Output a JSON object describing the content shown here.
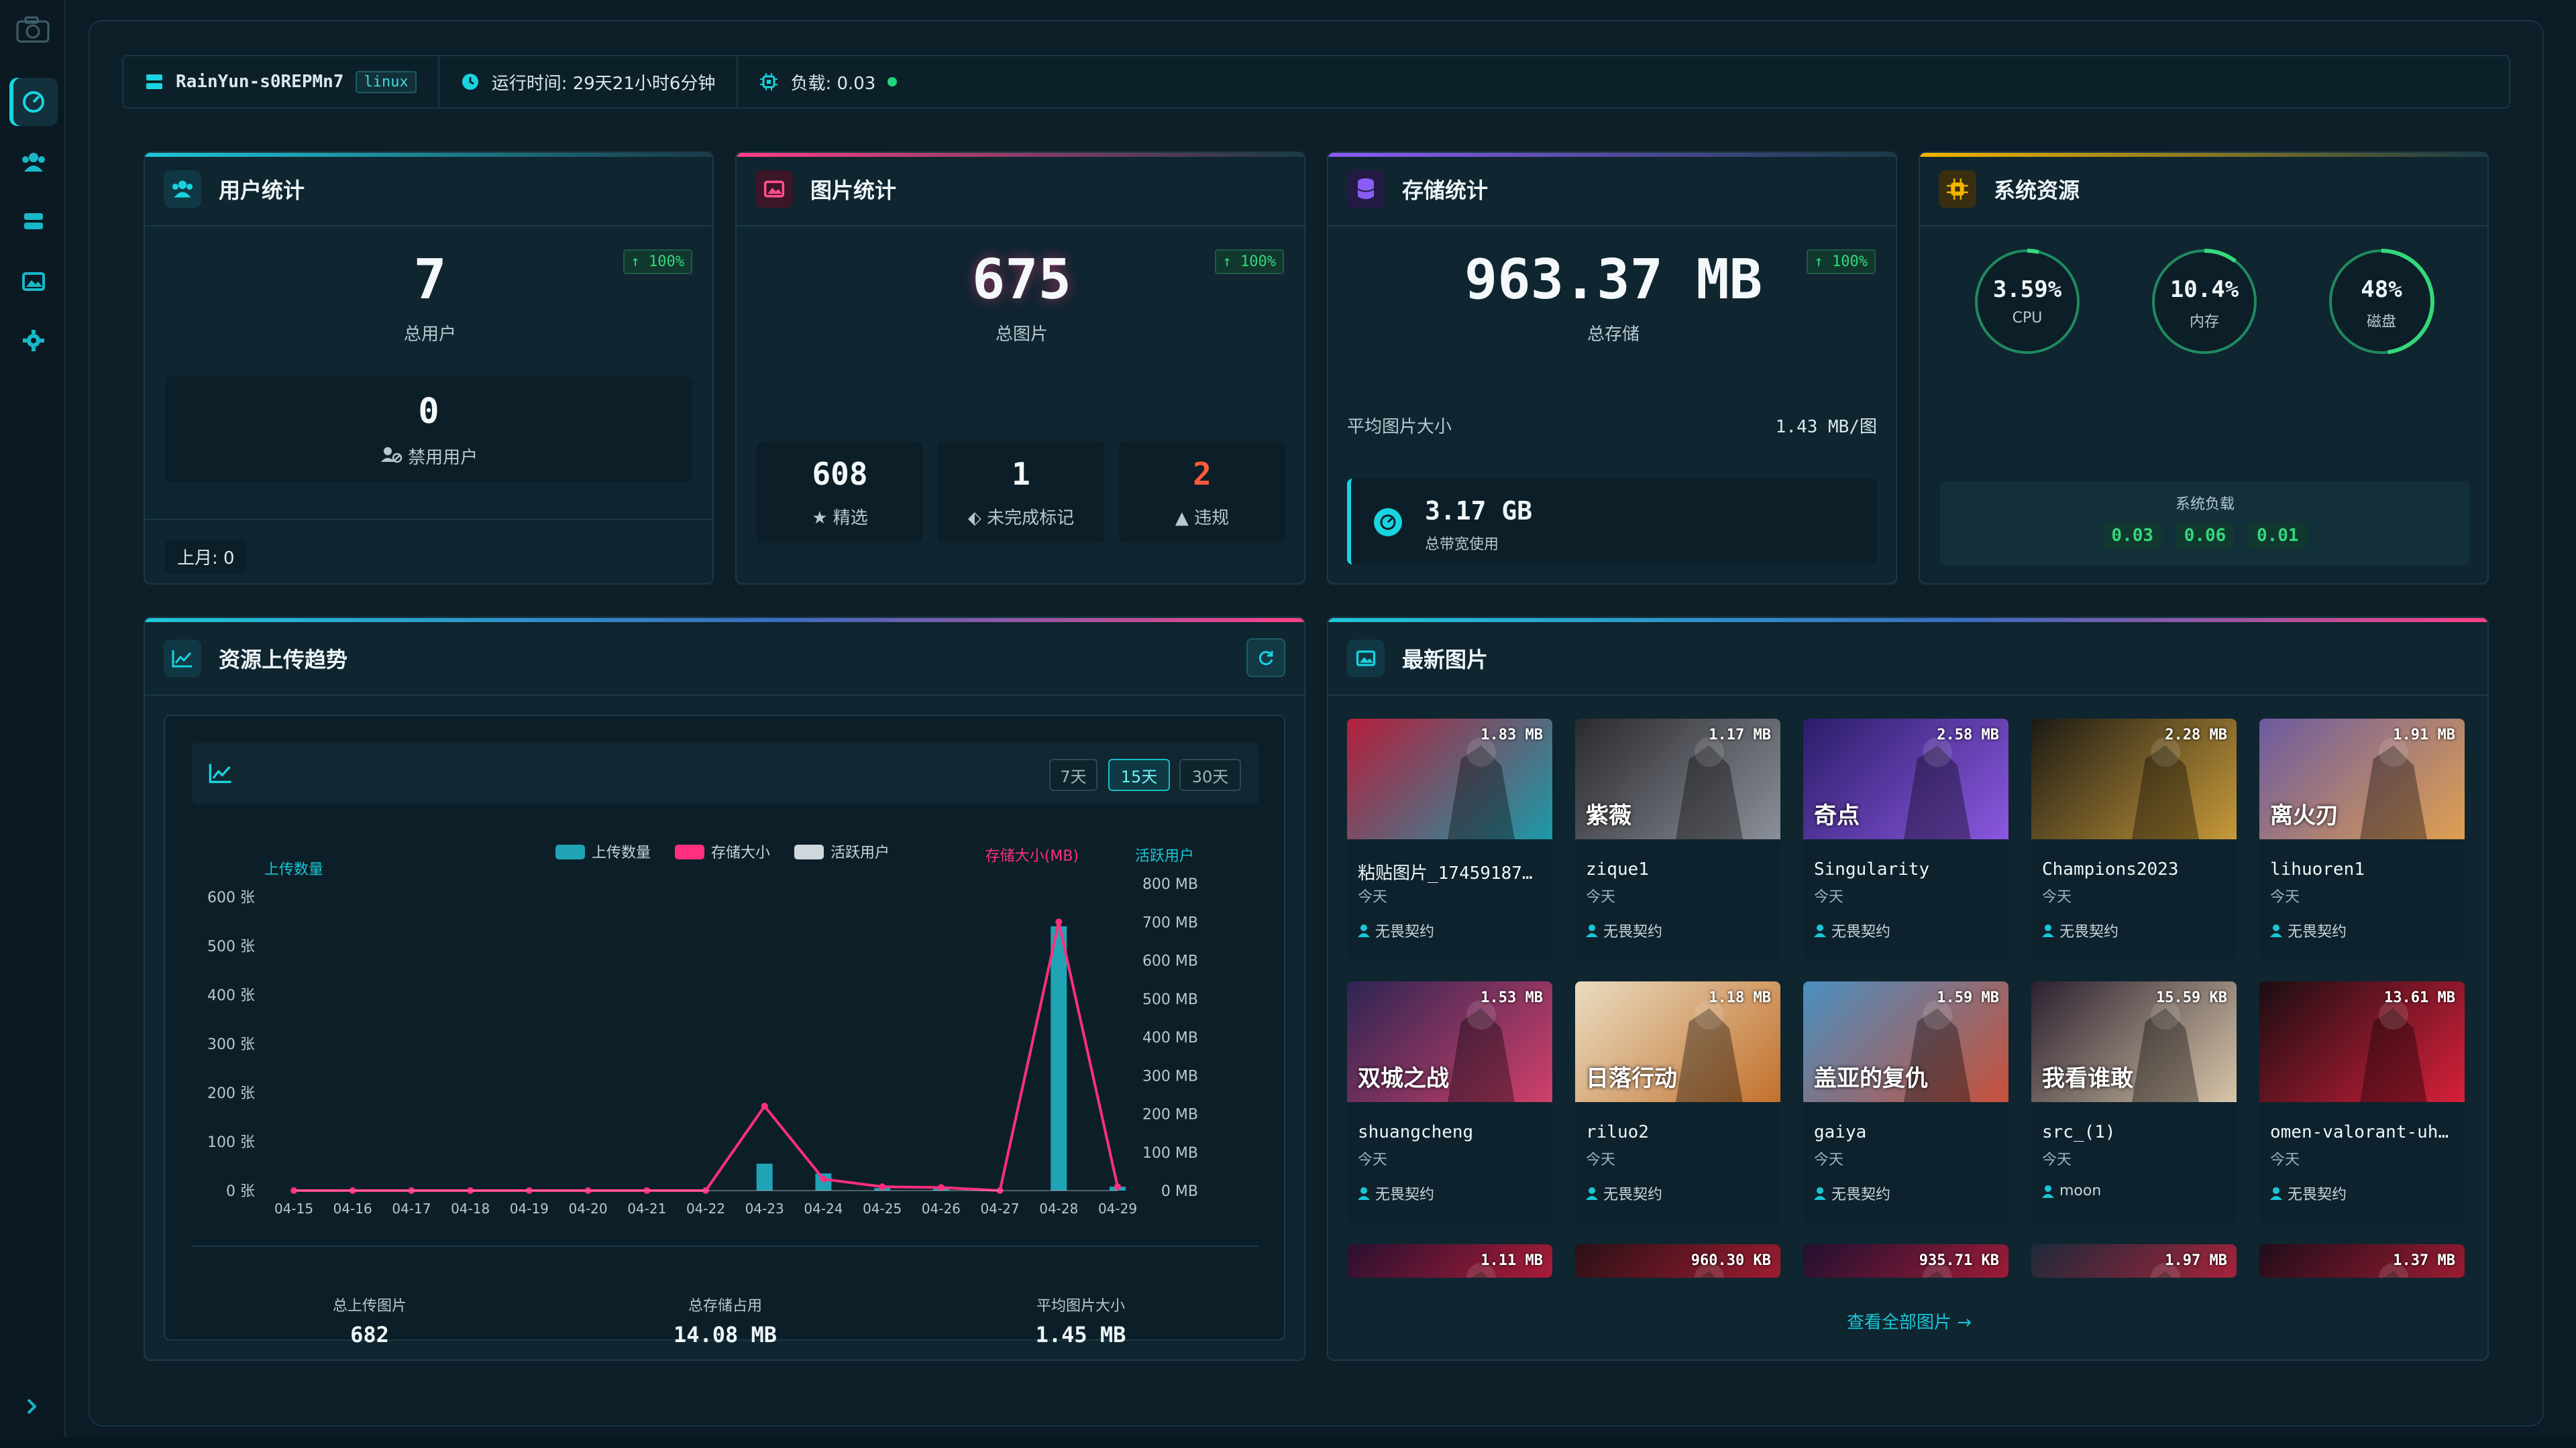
{
  "status": {
    "host": "RainYun-s0REPMn7",
    "os": "linux",
    "uptime": "运行时间: 29天21小时6分钟",
    "load": "负载: 0.03"
  },
  "users": {
    "title": "用户统计",
    "total": "7",
    "total_label": "总用户",
    "growth": "100%",
    "banned": "0",
    "banned_label": "禁用用户",
    "last_month": "上月: 0"
  },
  "images": {
    "title": "图片统计",
    "total": "675",
    "total_label": "总图片",
    "growth": "100%",
    "featured": "608",
    "featured_label": "精选",
    "unmarked": "1",
    "unmarked_label": "未完成标记",
    "violations": "2",
    "violations_label": "违规"
  },
  "storage": {
    "title": "存储统计",
    "total": "963.37 MB",
    "total_label": "总存储",
    "growth": "100%",
    "avg_label": "平均图片大小",
    "avg_value": "1.43 MB/图",
    "bandwidth": "3.17 GB",
    "bandwidth_label": "总带宽使用"
  },
  "system": {
    "title": "系统资源",
    "cpu": {
      "value": "3.59%",
      "label": "CPU",
      "fraction": 0.0359
    },
    "mem": {
      "value": "10.4%",
      "label": "内存",
      "fraction": 0.104
    },
    "disk": {
      "value": "48%",
      "label": "磁盘",
      "fraction": 0.48
    },
    "load_title": "系统负载",
    "loads": [
      "0.03",
      "0.06",
      "0.01"
    ]
  },
  "trend": {
    "title": "资源上传趋势",
    "ranges": [
      "7天",
      "15天",
      "30天"
    ],
    "active_range": "15天",
    "summary": [
      {
        "label": "总上传图片",
        "value": "682"
      },
      {
        "label": "总存储占用",
        "value": "14.08 MB"
      },
      {
        "label": "平均图片大小",
        "value": "1.45 MB"
      }
    ]
  },
  "chart_data": {
    "type": "bar",
    "categories": [
      "04-15",
      "04-16",
      "04-17",
      "04-18",
      "04-19",
      "04-20",
      "04-21",
      "04-22",
      "04-23",
      "04-24",
      "04-25",
      "04-26",
      "04-27",
      "04-28",
      "04-29"
    ],
    "series": [
      {
        "name": "上传数量",
        "type": "bar",
        "axis": "left",
        "color": "#1fa3b5",
        "values": [
          0,
          0,
          0,
          0,
          0,
          0,
          0,
          0,
          55,
          35,
          5,
          4,
          0,
          540,
          8
        ]
      },
      {
        "name": "存储大小",
        "type": "line",
        "axis": "right",
        "color": "#ff2f7d",
        "values": [
          0,
          0,
          0,
          0,
          0,
          0,
          0,
          0,
          220,
          30,
          10,
          8,
          0,
          700,
          10
        ]
      },
      {
        "name": "活跃用户",
        "type": "line",
        "axis": "right2",
        "color": "#cfd8dc",
        "values": [
          0,
          0,
          0,
          0,
          0,
          0,
          0,
          0,
          0,
          0,
          0,
          0,
          0,
          0,
          0
        ]
      }
    ],
    "y_left": {
      "label": "上传数量",
      "ticks": [
        "0 张",
        "100 张",
        "200 张",
        "300 张",
        "400 张",
        "500 张",
        "600 张"
      ],
      "range": [
        0,
        600
      ]
    },
    "y_right": {
      "label": "存储大小(MB)",
      "ticks": [
        "0 MB",
        "100 MB",
        "200 MB",
        "300 MB",
        "400 MB",
        "500 MB",
        "600 MB",
        "700 MB",
        "800 MB"
      ],
      "range": [
        0,
        800
      ]
    },
    "y_right2_label": "活跃用户",
    "legend_position": "top-center"
  },
  "latest": {
    "title": "最新图片",
    "view_all": "查看全部图片",
    "items": [
      {
        "name": "粘贴图片_174591871…",
        "date": "今天",
        "owner": "无畏契约",
        "size": "1.83 MB",
        "c1": "#b51e3c",
        "c2": "#1b9aa8",
        "overlay": ""
      },
      {
        "name": "zique1",
        "date": "今天",
        "owner": "无畏契约",
        "size": "1.17 MB",
        "c1": "#2a2a2e",
        "c2": "#8b8f99",
        "overlay": "紫薇"
      },
      {
        "name": "Singularity",
        "date": "今天",
        "owner": "无畏契约",
        "size": "2.58 MB",
        "c1": "#2b1d6a",
        "c2": "#8b58e0",
        "overlay": "奇点"
      },
      {
        "name": "Champions2023",
        "date": "今天",
        "owner": "无畏契约",
        "size": "2.28 MB",
        "c1": "#1c1a14",
        "c2": "#c79a3a",
        "overlay": ""
      },
      {
        "name": "lihuoren1",
        "date": "今天",
        "owner": "无畏契约",
        "size": "1.91 MB",
        "c1": "#6c5aa0",
        "c2": "#e0a050",
        "overlay": "离火刃"
      },
      {
        "name": "shuangcheng",
        "date": "今天",
        "owner": "无畏契约",
        "size": "1.53 MB",
        "c1": "#2d2553",
        "c2": "#d0406a",
        "overlay": "双城之战"
      },
      {
        "name": "riluo2",
        "date": "今天",
        "owner": "无畏契约",
        "size": "1.18 MB",
        "c1": "#e9dcc0",
        "c2": "#c2702c",
        "overlay": "日落行动"
      },
      {
        "name": "gaiya",
        "date": "今天",
        "owner": "无畏契约",
        "size": "1.59 MB",
        "c1": "#4a8fc0",
        "c2": "#c8503a",
        "overlay": "盖亚的复仇"
      },
      {
        "name": "src_(1)",
        "date": "今天",
        "owner": "moon",
        "size": "15.59 KB",
        "c1": "#2a2030",
        "c2": "#d8c6a8",
        "overlay": "我看谁敢"
      },
      {
        "name": "omen-valorant-uh…",
        "date": "今天",
        "owner": "无畏契约",
        "size": "13.61 MB",
        "c1": "#1a0d12",
        "c2": "#d8203a",
        "overlay": ""
      },
      {
        "size": "1.11 MB",
        "c1": "#2a1030",
        "c2": "#d8203a"
      },
      {
        "size": "960.30 KB",
        "c1": "#2a1016",
        "c2": "#c8203a"
      },
      {
        "size": "935.71 KB",
        "c1": "#221030",
        "c2": "#c8203a"
      },
      {
        "size": "1.97 MB",
        "c1": "#1c2a3a",
        "c2": "#d8203a"
      },
      {
        "size": "1.37 MB",
        "c1": "#200d1a",
        "c2": "#c8203a"
      }
    ]
  },
  "colors": {
    "accent": "#19d3e0",
    "pink": "#ff2f7d",
    "green": "#34d87a",
    "danger": "#ff5a3c"
  }
}
